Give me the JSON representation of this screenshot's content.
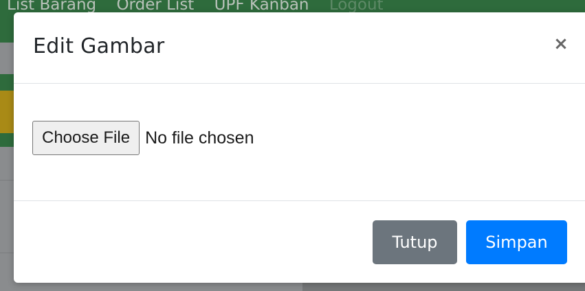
{
  "background": {
    "nav_links": [
      "List Barang",
      "Order List",
      "UPF Kanban"
    ],
    "nav_logout": "Logout",
    "colors": {
      "nav": "#2e6b3c",
      "band_yellow": "#a98a16"
    }
  },
  "modal": {
    "title": "Edit Gambar",
    "close_symbol": "×",
    "file_input": {
      "button_label": "Choose File",
      "status": "No file chosen"
    },
    "footer": {
      "close_label": "Tutup",
      "save_label": "Simpan"
    },
    "colors": {
      "primary": "#007bff",
      "secondary": "#6c757d"
    }
  }
}
